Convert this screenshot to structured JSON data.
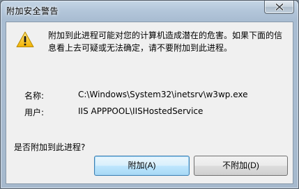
{
  "window": {
    "title": "附加安全警告"
  },
  "message": "附加到此进程可能对您的计算机造成潜在的危害。如果下面的信息看上去可疑或无法确定，请不要附加到此进程。",
  "details": {
    "name_label": "名称:",
    "name_value": "C:\\Windows\\System32\\inetsrv\\w3wp.exe",
    "user_label": "用户:",
    "user_value": "IIS APPPOOL\\IISHostedService"
  },
  "question": "是否附加到此进程?",
  "buttons": {
    "attach": "附加(A)",
    "dont_attach": "不附加(D)"
  },
  "icons": {
    "warning": "warning-icon",
    "close": "close-icon"
  }
}
